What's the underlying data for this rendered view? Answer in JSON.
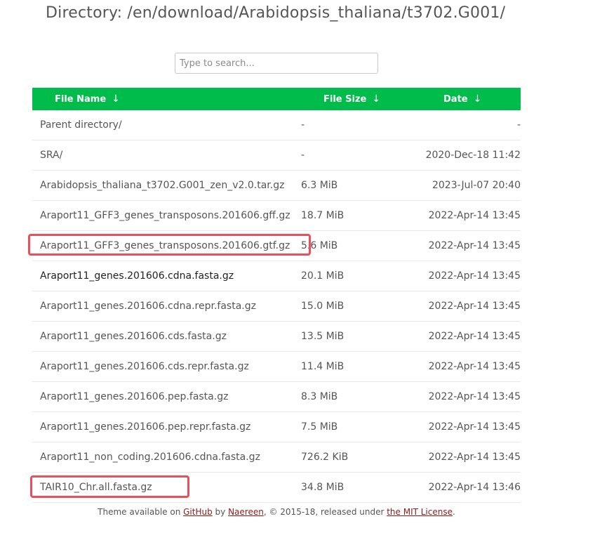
{
  "header": {
    "title": "Directory: /en/download/Arabidopsis_thaliana/t3702.G001/"
  },
  "search": {
    "placeholder": "Type to search..."
  },
  "table": {
    "headers": {
      "name": "File Name",
      "size": "File Size",
      "date": "Date",
      "sort_arrow": "↓"
    },
    "rows": [
      {
        "name": "Parent directory/",
        "size": "-",
        "date": "-"
      },
      {
        "name": "SRA/",
        "size": "-",
        "date": "2020-Dec-18 11:42"
      },
      {
        "name": "Arabidopsis_thaliana_t3702.G001_zen_v2.0.tar.gz",
        "size": "6.3 MiB",
        "date": "2023-Jul-07 20:40"
      },
      {
        "name": "Araport11_GFF3_genes_transposons.201606.gff.gz",
        "size": "18.7 MiB",
        "date": "2022-Apr-14 13:45"
      },
      {
        "name": "Araport11_GFF3_genes_transposons.201606.gtf.gz",
        "size": "5.6 MiB",
        "date": "2022-Apr-14 13:45"
      },
      {
        "name": "Araport11_genes.201606.cdna.fasta.gz",
        "size": "20.1 MiB",
        "date": "2022-Apr-14 13:45"
      },
      {
        "name": "Araport11_genes.201606.cdna.repr.fasta.gz",
        "size": "15.0 MiB",
        "date": "2022-Apr-14 13:45"
      },
      {
        "name": "Araport11_genes.201606.cds.fasta.gz",
        "size": "13.5 MiB",
        "date": "2022-Apr-14 13:45"
      },
      {
        "name": "Araport11_genes.201606.cds.repr.fasta.gz",
        "size": "11.4 MiB",
        "date": "2022-Apr-14 13:45"
      },
      {
        "name": "Araport11_genes.201606.pep.fasta.gz",
        "size": "8.3 MiB",
        "date": "2022-Apr-14 13:45"
      },
      {
        "name": "Araport11_genes.201606.pep.repr.fasta.gz",
        "size": "7.5 MiB",
        "date": "2022-Apr-14 13:45"
      },
      {
        "name": "Araport11_non_coding.201606.cdna.fasta.gz",
        "size": "726.2 KiB",
        "date": "2022-Apr-14 13:45"
      },
      {
        "name": "TAIR10_Chr.all.fasta.gz",
        "size": "34.8 MiB",
        "date": "2022-Apr-14 13:46"
      }
    ]
  },
  "footer": {
    "prefix": "Theme available on ",
    "github": "GitHub",
    "by": " by ",
    "author": "Naereen",
    "middle": ", © 2015-18, released under ",
    "license": "the MIT License",
    "suffix": "."
  },
  "colors": {
    "header_green": "#00bc4a",
    "highlight_red": "#e8505b",
    "link_dark_red": "#8b1a1a"
  }
}
